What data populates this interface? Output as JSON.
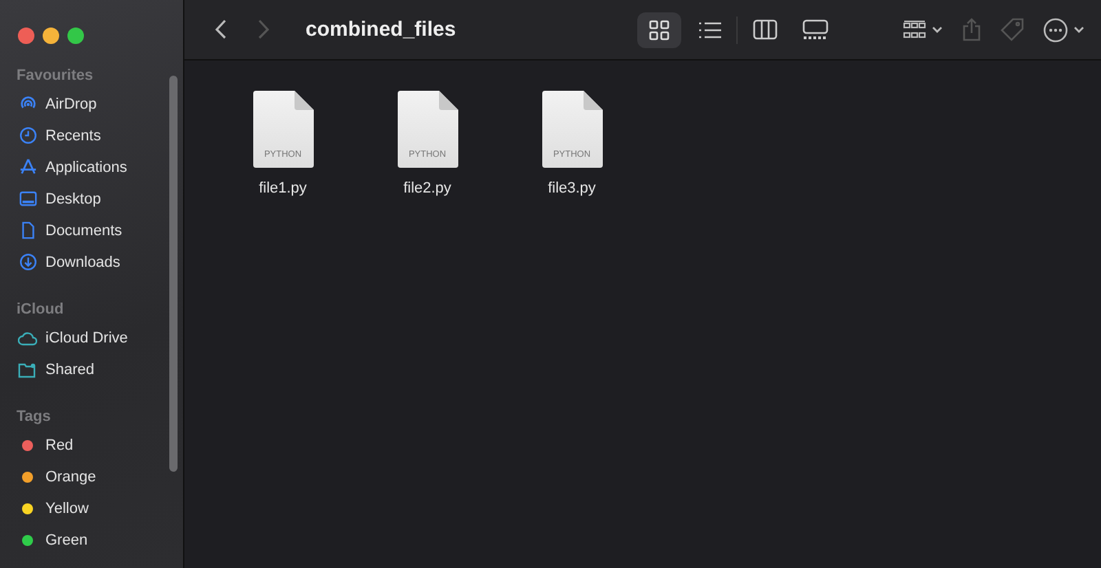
{
  "window": {
    "title": "combined_files"
  },
  "sidebar": {
    "sections": [
      {
        "heading": "Favourites",
        "items": [
          {
            "label": "AirDrop"
          },
          {
            "label": "Recents"
          },
          {
            "label": "Applications"
          },
          {
            "label": "Desktop"
          },
          {
            "label": "Documents"
          },
          {
            "label": "Downloads"
          }
        ]
      },
      {
        "heading": "iCloud",
        "items": [
          {
            "label": "iCloud Drive"
          },
          {
            "label": "Shared"
          }
        ]
      },
      {
        "heading": "Tags",
        "items": [
          {
            "label": "Red",
            "color": "#ec5f5c"
          },
          {
            "label": "Orange",
            "color": "#f29f2a"
          },
          {
            "label": "Yellow",
            "color": "#f9d423"
          },
          {
            "label": "Green",
            "color": "#2fcc4a"
          }
        ]
      }
    ]
  },
  "views": [
    {
      "selected": true
    },
    {
      "selected": false
    },
    {
      "selected": false
    },
    {
      "selected": false
    }
  ],
  "files": [
    {
      "name": "file1.py",
      "type": "PYTHON"
    },
    {
      "name": "file2.py",
      "type": "PYTHON"
    },
    {
      "name": "file3.py",
      "type": "PYTHON"
    }
  ]
}
